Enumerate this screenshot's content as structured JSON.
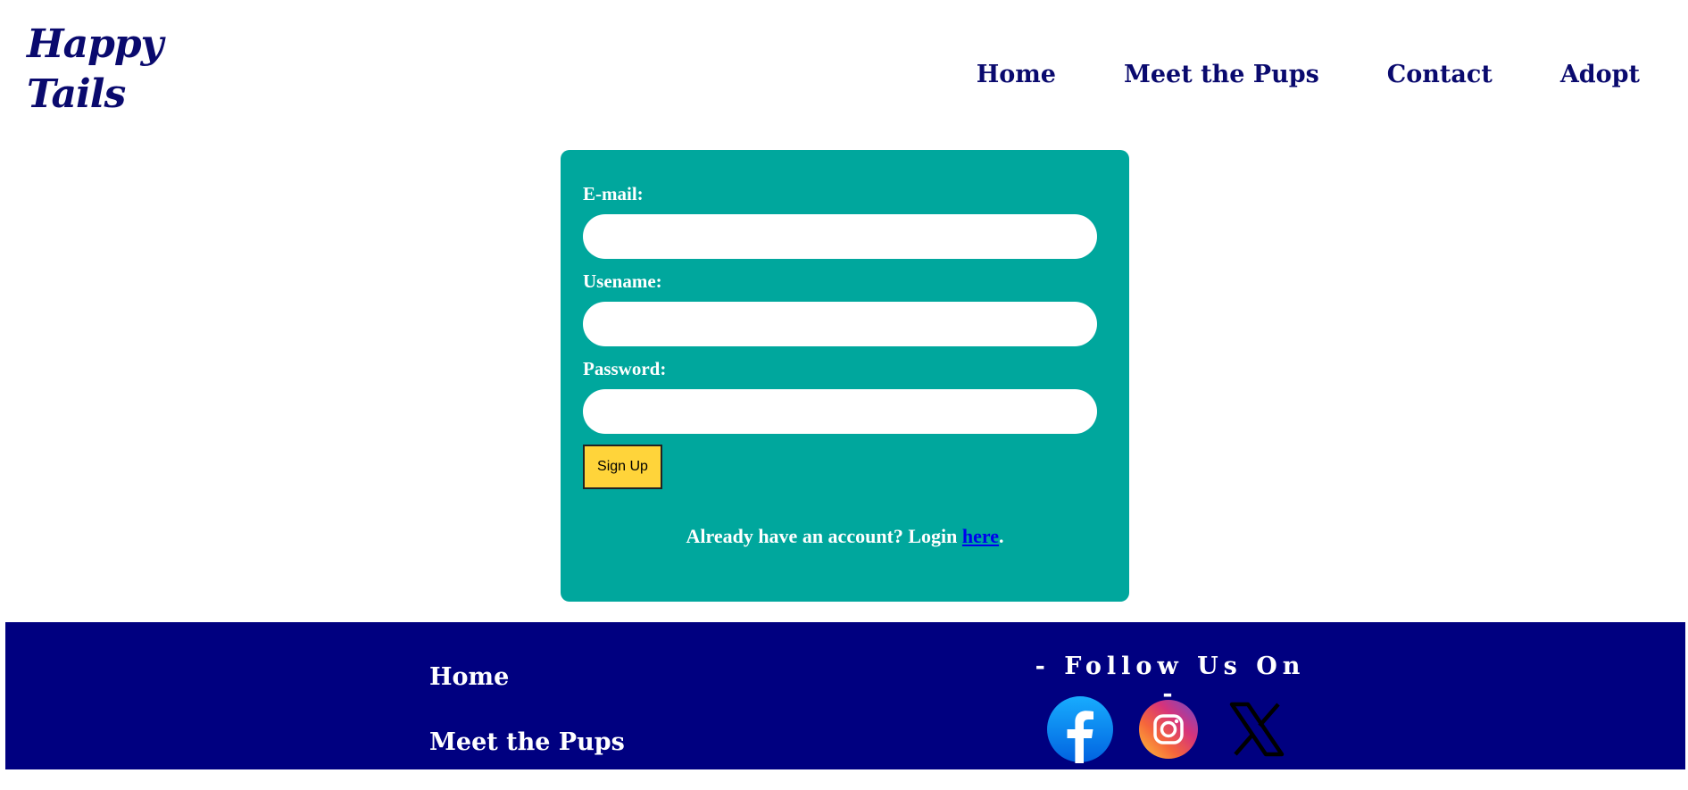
{
  "logo": {
    "line1": "Happy",
    "line2": "Tails"
  },
  "nav": {
    "home": "Home",
    "pups": "Meet the Pups",
    "contact": "Contact",
    "adopt": "Adopt"
  },
  "form": {
    "email_label": "E-mail:",
    "username_label": "Usename:",
    "password_label": "Password:",
    "signup_label": "Sign Up",
    "login_text": "Already have an account? Login ",
    "login_link": "here",
    "login_end": "."
  },
  "footer": {
    "home": "Home",
    "pups": "Meet the Pups",
    "follow": "- Follow Us On -",
    "icons": [
      "facebook-icon",
      "instagram-icon",
      "x-icon"
    ]
  },
  "colors": {
    "brand_navy": "#0a0a6e",
    "footer_bg": "#000080",
    "card_teal": "#00a79d",
    "button_yellow": "#ffd43a"
  }
}
